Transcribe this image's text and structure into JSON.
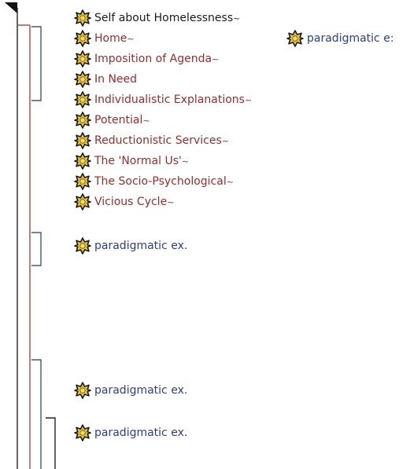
{
  "colors": {
    "code_red": "#9e2a2a",
    "code_black": "#1a1a1a",
    "memo_blue": "#2a3e8c",
    "bracket_blue": "#3a55a8",
    "bracket_red": "#b0443c",
    "bracket_black": "#222222",
    "icon_fill": "#e4c23c",
    "icon_outline": "#1a1a1a"
  },
  "tree": {
    "codes": [
      {
        "label": "Self about Homelessness",
        "suffix": "~",
        "color": "#1a1a1a",
        "icon": "code-star-icon"
      },
      {
        "label": "Home",
        "suffix": "~",
        "color": "#9e2a2a",
        "icon": "code-star-icon"
      },
      {
        "label": "Imposition of Agenda",
        "suffix": "~",
        "color": "#9e2a2a",
        "icon": "code-star-icon"
      },
      {
        "label": "In Need",
        "suffix": "",
        "color": "#9e2a2a",
        "icon": "code-star-icon"
      },
      {
        "label": "Individualistic Explanations",
        "suffix": "~",
        "color": "#9e2a2a",
        "icon": "code-star-icon"
      },
      {
        "label": "Potential",
        "suffix": "~",
        "color": "#9e2a2a",
        "icon": "code-star-icon"
      },
      {
        "label": "Reductionistic Services",
        "suffix": "~",
        "color": "#9e2a2a",
        "icon": "code-star-icon"
      },
      {
        "label": "The 'Normal Us'",
        "suffix": "~",
        "color": "#9e2a2a",
        "icon": "code-star-icon"
      },
      {
        "label": "The Socio-Psychological",
        "suffix": "~",
        "color": "#9e2a2a",
        "icon": "code-star-icon"
      },
      {
        "label": "Vicious Cycle",
        "suffix": "~",
        "color": "#9e2a2a",
        "icon": "code-star-icon"
      }
    ],
    "memos": [
      {
        "label": "paradigmatic e:",
        "color": "#2a3e8c"
      },
      {
        "label": "paradigmatic ex.",
        "color": "#2a3e8c"
      },
      {
        "label": "paradigmatic ex.",
        "color": "#2a3e8c"
      },
      {
        "label": "paradigmatic ex.",
        "color": "#2a3e8c"
      }
    ]
  }
}
